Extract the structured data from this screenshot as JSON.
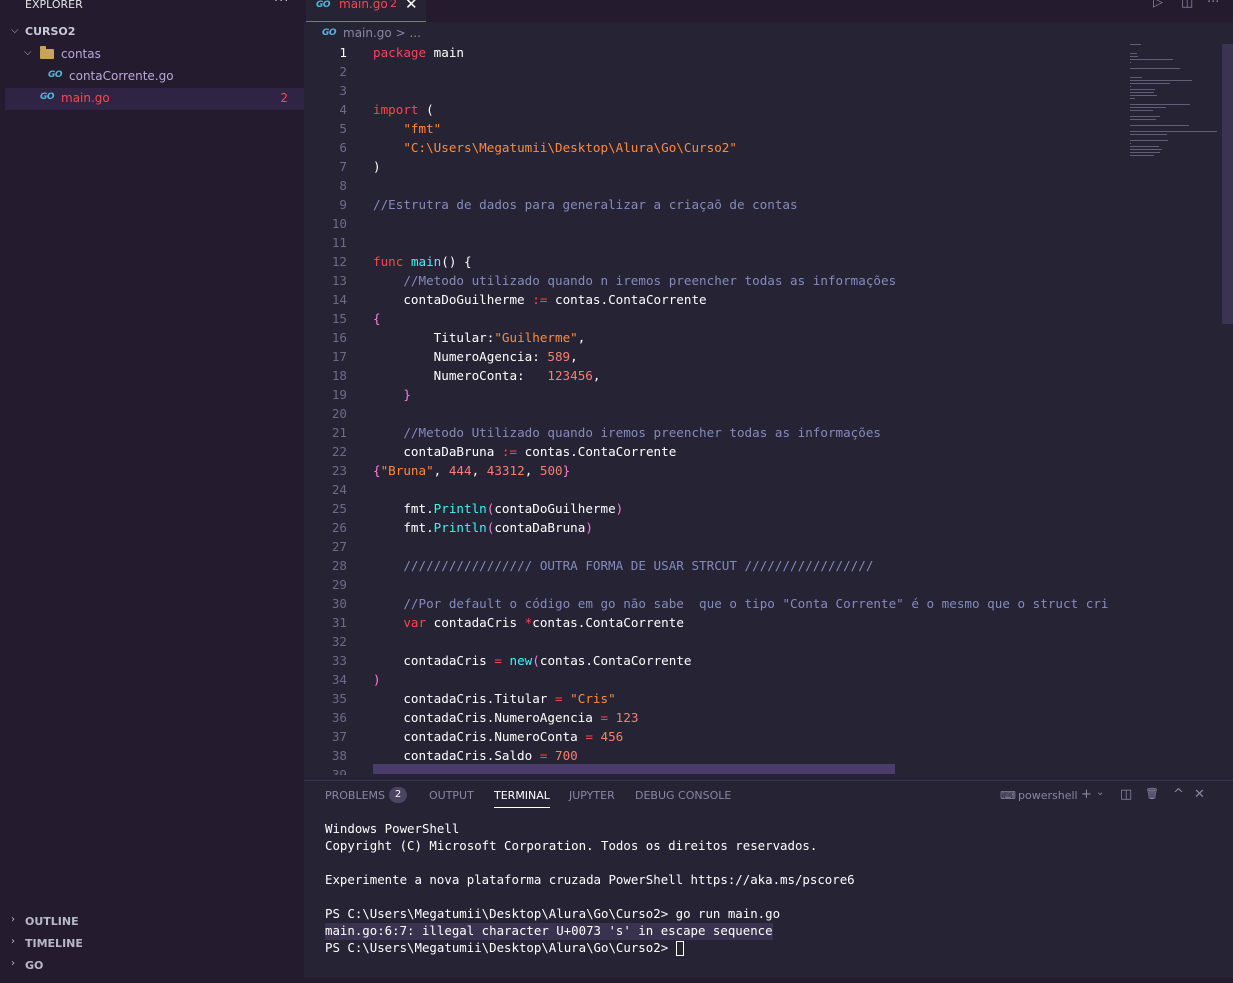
{
  "sidebar": {
    "title": "EXPLORER",
    "more": "···",
    "root_folder": "CURSO2",
    "items": [
      {
        "label": "contas",
        "type": "folder"
      },
      {
        "label": "contaCorrente.go",
        "type": "file"
      },
      {
        "label": "main.go",
        "type": "file",
        "badge": "2"
      }
    ],
    "sections": [
      "OUTLINE",
      "TIMELINE",
      "GO"
    ]
  },
  "tabs": [
    {
      "label": "main.go",
      "count": "2",
      "close": "✕",
      "icon": "GO"
    }
  ],
  "editor_actions": [
    "▷",
    "◫",
    "···"
  ],
  "breadcrumb": {
    "text": "main.go > ...",
    "icon": "GO"
  },
  "code_lines": [
    {
      "n": "1",
      "html": "<span class='tk-kw2'>package</span> main"
    },
    {
      "n": "2",
      "html": ""
    },
    {
      "n": "3",
      "html": ""
    },
    {
      "n": "4",
      "html": "<span class='tk-kw2'>import</span> ("
    },
    {
      "n": "5",
      "html": "    <span class='tk-str'>\"fmt\"</span>"
    },
    {
      "n": "6",
      "html": "    <span class='tk-str'>\"C:\\Users\\Megatumii\\Desktop\\Alura\\Go\\Curso2\"</span>"
    },
    {
      "n": "7",
      "html": ")"
    },
    {
      "n": "8",
      "html": ""
    },
    {
      "n": "9",
      "html": "<span class='tk-cm'>//Estrutra de dados para generalizar a criaçaõ de contas</span>"
    },
    {
      "n": "10",
      "html": ""
    },
    {
      "n": "11",
      "html": ""
    },
    {
      "n": "12",
      "html": "<span class='tk-kw2'>func</span> <span class='tk-fn'>main</span>() {"
    },
    {
      "n": "13",
      "html": "    <span class='tk-cm'>//Metodo utilizado quando n iremos preencher todas as informações</span>"
    },
    {
      "n": "14",
      "html": "    contaDoGuilherme <span class='tk-op'>:=</span> contas.ContaCorrente"
    },
    {
      "n": "15",
      "html": "<span class='tk-br'>{</span>"
    },
    {
      "n": "16",
      "html": "        Titular:<span class='tk-str'>\"Guilherme\"</span>,"
    },
    {
      "n": "17",
      "html": "        NumeroAgencia: <span class='tk-num'>589</span>,"
    },
    {
      "n": "18",
      "html": "        NumeroConta:   <span class='tk-num'>123456</span>,"
    },
    {
      "n": "19",
      "html": "    <span class='tk-br'>}</span>"
    },
    {
      "n": "20",
      "html": ""
    },
    {
      "n": "21",
      "html": "    <span class='tk-cm'>//Metodo Utilizado quando iremos preencher todas as informações</span>"
    },
    {
      "n": "22",
      "html": "    contaDaBruna <span class='tk-op'>:=</span> contas.ContaCorrente"
    },
    {
      "n": "23",
      "html": "<span class='tk-br'>{</span><span class='tk-str'>\"Bruna\"</span>, <span class='tk-num'>444</span>, <span class='tk-num'>43312</span>, <span class='tk-num'>500</span><span class='tk-br'>}</span>"
    },
    {
      "n": "24",
      "html": ""
    },
    {
      "n": "25",
      "html": "    fmt.<span class='tk-fn'>Println</span><span class='tk-br'>(</span>contaDoGuilherme<span class='tk-br'>)</span>"
    },
    {
      "n": "26",
      "html": "    fmt.<span class='tk-fn'>Println</span><span class='tk-br'>(</span>contaDaBruna<span class='tk-br'>)</span>"
    },
    {
      "n": "27",
      "html": ""
    },
    {
      "n": "28",
      "html": "    <span class='tk-cm'>///////////////// OUTRA FORMA DE USAR STRCUT /////////////////</span>"
    },
    {
      "n": "29",
      "html": ""
    },
    {
      "n": "30",
      "html": "    <span class='tk-cm'>//Por default o código em go não sabe  que o tipo \"Conta Corrente\" é o mesmo que o struct cri</span>"
    },
    {
      "n": "31",
      "html": "    <span class='tk-kw2'>var</span> contadaCris <span class='tk-op'>*</span>contas.ContaCorrente"
    },
    {
      "n": "32",
      "html": ""
    },
    {
      "n": "33",
      "html": "    contadaCris <span class='tk-op'>=</span> <span class='tk-fn'>new</span><span class='tk-br'>(</span>contas.ContaCorrente"
    },
    {
      "n": "34",
      "html": "<span class='tk-br'>)</span>"
    },
    {
      "n": "35",
      "html": "    contadaCris.Titular <span class='tk-op'>=</span> <span class='tk-str'>\"Cris\"</span>"
    },
    {
      "n": "36",
      "html": "    contadaCris.NumeroAgencia <span class='tk-op'>=</span> <span class='tk-num'>123</span>"
    },
    {
      "n": "37",
      "html": "    contadaCris.NumeroConta <span class='tk-op'>=</span> <span class='tk-num'>456</span>"
    },
    {
      "n": "38",
      "html": "    contadaCris.Saldo <span class='tk-op'>=</span> <span class='tk-num'>700</span>"
    },
    {
      "n": "39",
      "html": ""
    }
  ],
  "panel": {
    "tabs": [
      "PROBLEMS",
      "OUTPUT",
      "TERMINAL",
      "JUPYTER",
      "DEBUG CONSOLE"
    ],
    "active_tab": "TERMINAL",
    "problems_count": "2",
    "shell": "powershell",
    "actions": [
      "+",
      "⌄",
      "◫",
      "🗑",
      "^",
      "✕"
    ],
    "terminal_lines": [
      "Windows PowerShell",
      "Copyright (C) Microsoft Corporation. Todos os direitos reservados.",
      "",
      "Experimente a nova plataforma cruzada PowerShell https://aka.ms/pscore6",
      "",
      "PS C:\\Users\\Megatumii\\Desktop\\Alura\\Go\\Curso2> go run main.go",
      "main.go:6:7: illegal character U+0073 's' in escape sequence",
      "PS C:\\Users\\Megatumii\\Desktop\\Alura\\Go\\Curso2> "
    ]
  }
}
